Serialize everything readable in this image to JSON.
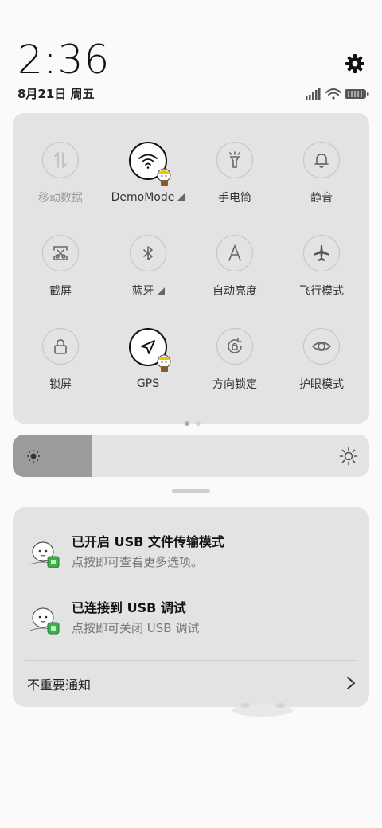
{
  "status": {
    "time": "2:36",
    "date": "8月21日 周五",
    "icons": [
      "signal-icon",
      "wifi-icon",
      "battery-icon"
    ]
  },
  "header": {
    "settings_icon": "gear-icon"
  },
  "quick_settings": {
    "tiles": [
      {
        "label": "移动数据",
        "icon": "mobile-data-icon",
        "active": false,
        "dim": true
      },
      {
        "label": "DemoMode",
        "icon": "wifi-icon",
        "active": true,
        "expandable": true
      },
      {
        "label": "手电筒",
        "icon": "flashlight-icon",
        "active": false
      },
      {
        "label": "静音",
        "icon": "bell-icon",
        "active": false
      },
      {
        "label": "截屏",
        "icon": "screenshot-icon",
        "active": false
      },
      {
        "label": "蓝牙",
        "icon": "bluetooth-icon",
        "active": false,
        "expandable": true
      },
      {
        "label": "自动亮度",
        "icon": "auto-brightness-icon",
        "active": false
      },
      {
        "label": "飞行模式",
        "icon": "airplane-icon",
        "active": false
      },
      {
        "label": "锁屏",
        "icon": "lock-icon",
        "active": false
      },
      {
        "label": "GPS",
        "icon": "location-arrow-icon",
        "active": true
      },
      {
        "label": "方向锁定",
        "icon": "rotation-lock-icon",
        "active": false
      },
      {
        "label": "护眼模式",
        "icon": "eye-icon",
        "active": false
      }
    ],
    "page_indicator": {
      "current": 1,
      "total": 2
    }
  },
  "brightness": {
    "level": 0.22
  },
  "notifications": {
    "items": [
      {
        "title": "已开启 USB 文件传输模式",
        "subtitle": "点按即可查看更多选项。"
      },
      {
        "title": "已连接到 USB 调试",
        "subtitle": "点按即可关闭 USB 调试"
      }
    ],
    "unimportant_label": "不重要通知"
  },
  "colors": {
    "panel_bg": "#e3e3e3",
    "brightness_fill": "#9b9b9b",
    "active_border": "#111111"
  }
}
